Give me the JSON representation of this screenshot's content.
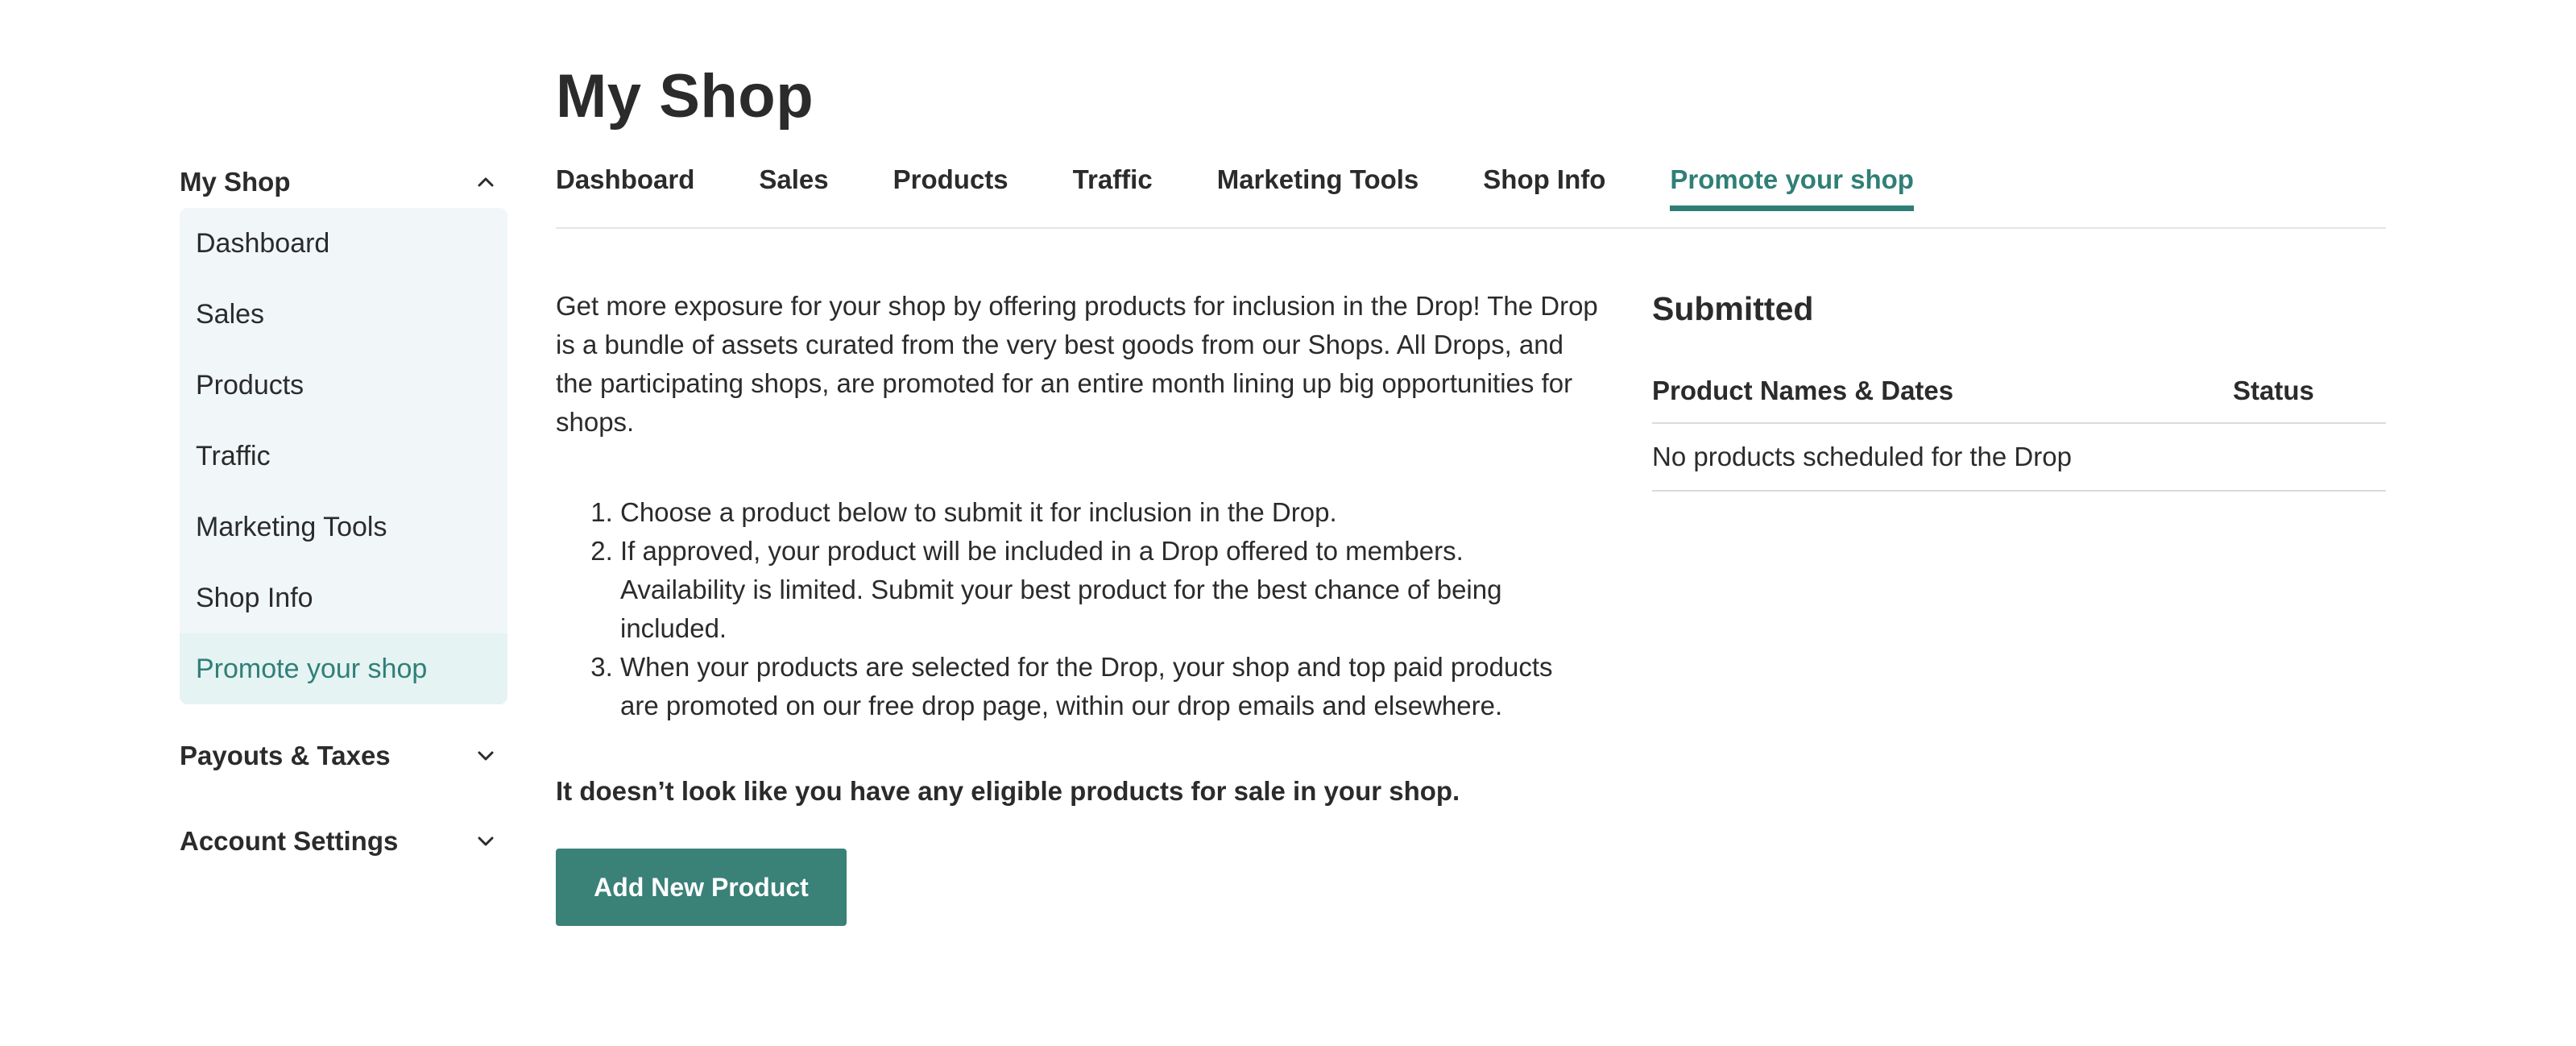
{
  "page": {
    "title": "My Shop"
  },
  "sidebar": {
    "my_shop": {
      "label": "My Shop",
      "items": [
        {
          "label": "Dashboard"
        },
        {
          "label": "Sales"
        },
        {
          "label": "Products"
        },
        {
          "label": "Traffic"
        },
        {
          "label": "Marketing Tools"
        },
        {
          "label": "Shop Info"
        },
        {
          "label": "Promote your shop",
          "active": true
        }
      ]
    },
    "payouts": {
      "label": "Payouts & Taxes"
    },
    "account": {
      "label": "Account Settings"
    }
  },
  "tabs": [
    {
      "label": "Dashboard"
    },
    {
      "label": "Sales"
    },
    {
      "label": "Products"
    },
    {
      "label": "Traffic"
    },
    {
      "label": "Marketing Tools"
    },
    {
      "label": "Shop Info"
    },
    {
      "label": "Promote your shop",
      "active": true
    }
  ],
  "content": {
    "intro": "Get more exposure for your shop by offering products for inclusion in the Drop! The Drop is a bundle of assets curated from the very best goods from our Shops. All Drops, and the participating shops, are promoted for an entire month lining up big opportunities for shops.",
    "steps": [
      "Choose a product below to submit it for inclusion in the Drop.",
      "If approved, your product will be included in a Drop offered to members. Availability is limited. Submit your best product for the best chance of being included.",
      "When your products are selected for the Drop, your shop and top paid products are promoted on our free drop page, within our drop emails and elsewhere."
    ],
    "notice": "It doesn’t look like you have any eligible products for sale in your shop.",
    "add_button": "Add New Product"
  },
  "submitted": {
    "title": "Submitted",
    "columns": [
      "Product Names & Dates",
      "Status"
    ],
    "empty_message": "No products scheduled for the Drop"
  },
  "colors": {
    "accent": "#307f77",
    "button": "#3a8178",
    "sidebar_bg": "#f1f6f9",
    "sidebar_active_bg": "#e5f3f3"
  }
}
